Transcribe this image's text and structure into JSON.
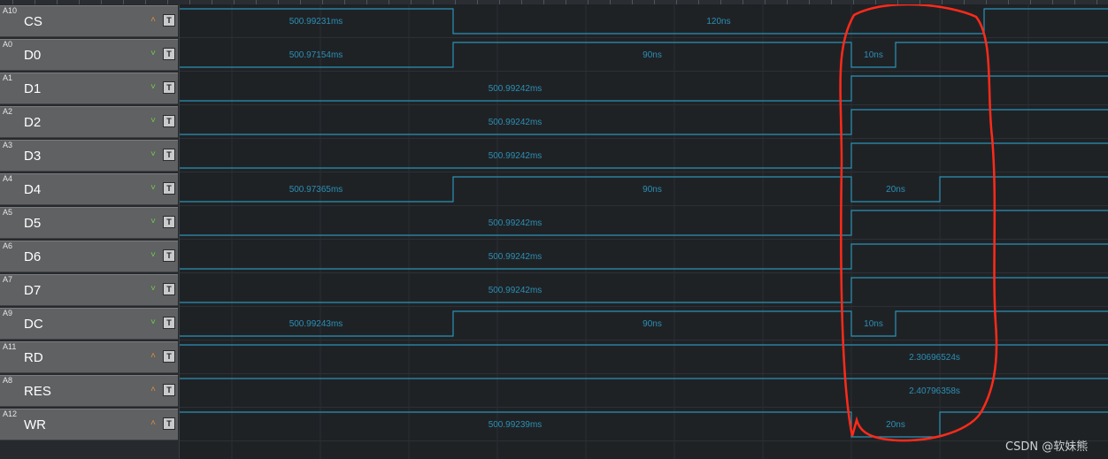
{
  "channels": [
    {
      "id": "A10",
      "name": "CS",
      "trigger": "up"
    },
    {
      "id": "A0",
      "name": "D0",
      "trigger": "down"
    },
    {
      "id": "A1",
      "name": "D1",
      "trigger": "down"
    },
    {
      "id": "A2",
      "name": "D2",
      "trigger": "down"
    },
    {
      "id": "A3",
      "name": "D3",
      "trigger": "down"
    },
    {
      "id": "A4",
      "name": "D4",
      "trigger": "down"
    },
    {
      "id": "A5",
      "name": "D5",
      "trigger": "down"
    },
    {
      "id": "A6",
      "name": "D6",
      "trigger": "down"
    },
    {
      "id": "A7",
      "name": "D7",
      "trigger": "down"
    },
    {
      "id": "A9",
      "name": "DC",
      "trigger": "down"
    },
    {
      "id": "A11",
      "name": "RD",
      "trigger": "up"
    },
    {
      "id": "A8",
      "name": "RES",
      "trigger": "up"
    },
    {
      "id": "A12",
      "name": "WR",
      "trigger": "up"
    }
  ],
  "t_button_label": "T",
  "icons": {
    "trigger_up": "caret-up-icon",
    "trigger_down": "caret-down-icon"
  },
  "wave_labels": {
    "CS": [
      "500.99231ms",
      "120ns"
    ],
    "D0": [
      "500.97154ms",
      "90ns",
      "10ns"
    ],
    "D1": [
      "500.99242ms"
    ],
    "D2": [
      "500.99242ms"
    ],
    "D3": [
      "500.99242ms"
    ],
    "D4": [
      "500.97365ms",
      "90ns",
      "20ns"
    ],
    "D5": [
      "500.99242ms"
    ],
    "D6": [
      "500.99242ms"
    ],
    "D7": [
      "500.99242ms"
    ],
    "DC": [
      "500.99243ms",
      "90ns",
      "10ns"
    ],
    "RD": [
      "2.30696524s"
    ],
    "RES": [
      "2.40796358s"
    ],
    "WR": [
      "500.99239ms",
      "20ns"
    ]
  },
  "watermark": "CSDN @软妹熊",
  "colors": {
    "signal": "#2a93b6",
    "annotation": "#ff2a1a",
    "label_bg": "#5f6163"
  }
}
